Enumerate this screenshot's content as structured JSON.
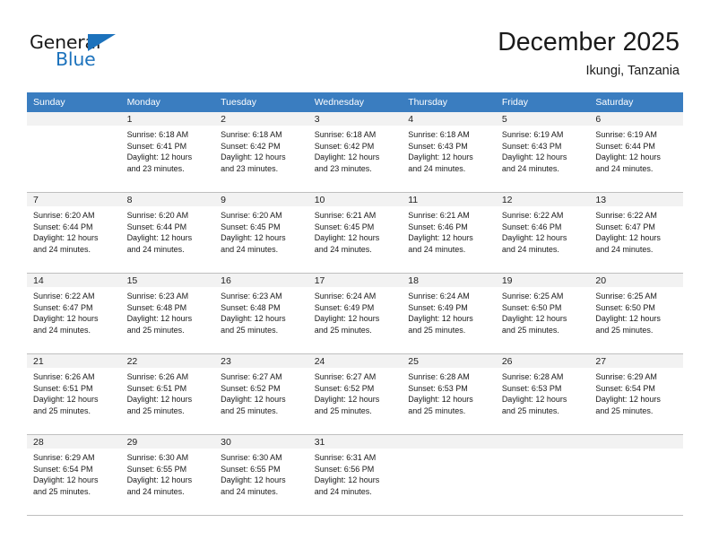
{
  "brand": {
    "name_top": "General",
    "name_bottom": "Blue",
    "triangle_icon": "triangle-icon",
    "accent_color": "#1c72bc"
  },
  "header": {
    "month_title": "December 2025",
    "location": "Ikungi, Tanzania"
  },
  "calendar": {
    "header_bg": "#3a7dc0",
    "daynum_bg": "#f2f2f2",
    "grid_line": "#bfbfbf",
    "weekday_headers": [
      "Sunday",
      "Monday",
      "Tuesday",
      "Wednesday",
      "Thursday",
      "Friday",
      "Saturday"
    ],
    "weeks": [
      [
        {
          "day": "",
          "lines": []
        },
        {
          "day": "1",
          "lines": [
            "Sunrise: 6:18 AM",
            "Sunset: 6:41 PM",
            "Daylight: 12 hours",
            "and 23 minutes."
          ]
        },
        {
          "day": "2",
          "lines": [
            "Sunrise: 6:18 AM",
            "Sunset: 6:42 PM",
            "Daylight: 12 hours",
            "and 23 minutes."
          ]
        },
        {
          "day": "3",
          "lines": [
            "Sunrise: 6:18 AM",
            "Sunset: 6:42 PM",
            "Daylight: 12 hours",
            "and 23 minutes."
          ]
        },
        {
          "day": "4",
          "lines": [
            "Sunrise: 6:18 AM",
            "Sunset: 6:43 PM",
            "Daylight: 12 hours",
            "and 24 minutes."
          ]
        },
        {
          "day": "5",
          "lines": [
            "Sunrise: 6:19 AM",
            "Sunset: 6:43 PM",
            "Daylight: 12 hours",
            "and 24 minutes."
          ]
        },
        {
          "day": "6",
          "lines": [
            "Sunrise: 6:19 AM",
            "Sunset: 6:44 PM",
            "Daylight: 12 hours",
            "and 24 minutes."
          ]
        }
      ],
      [
        {
          "day": "7",
          "lines": [
            "Sunrise: 6:20 AM",
            "Sunset: 6:44 PM",
            "Daylight: 12 hours",
            "and 24 minutes."
          ]
        },
        {
          "day": "8",
          "lines": [
            "Sunrise: 6:20 AM",
            "Sunset: 6:44 PM",
            "Daylight: 12 hours",
            "and 24 minutes."
          ]
        },
        {
          "day": "9",
          "lines": [
            "Sunrise: 6:20 AM",
            "Sunset: 6:45 PM",
            "Daylight: 12 hours",
            "and 24 minutes."
          ]
        },
        {
          "day": "10",
          "lines": [
            "Sunrise: 6:21 AM",
            "Sunset: 6:45 PM",
            "Daylight: 12 hours",
            "and 24 minutes."
          ]
        },
        {
          "day": "11",
          "lines": [
            "Sunrise: 6:21 AM",
            "Sunset: 6:46 PM",
            "Daylight: 12 hours",
            "and 24 minutes."
          ]
        },
        {
          "day": "12",
          "lines": [
            "Sunrise: 6:22 AM",
            "Sunset: 6:46 PM",
            "Daylight: 12 hours",
            "and 24 minutes."
          ]
        },
        {
          "day": "13",
          "lines": [
            "Sunrise: 6:22 AM",
            "Sunset: 6:47 PM",
            "Daylight: 12 hours",
            "and 24 minutes."
          ]
        }
      ],
      [
        {
          "day": "14",
          "lines": [
            "Sunrise: 6:22 AM",
            "Sunset: 6:47 PM",
            "Daylight: 12 hours",
            "and 24 minutes."
          ]
        },
        {
          "day": "15",
          "lines": [
            "Sunrise: 6:23 AM",
            "Sunset: 6:48 PM",
            "Daylight: 12 hours",
            "and 25 minutes."
          ]
        },
        {
          "day": "16",
          "lines": [
            "Sunrise: 6:23 AM",
            "Sunset: 6:48 PM",
            "Daylight: 12 hours",
            "and 25 minutes."
          ]
        },
        {
          "day": "17",
          "lines": [
            "Sunrise: 6:24 AM",
            "Sunset: 6:49 PM",
            "Daylight: 12 hours",
            "and 25 minutes."
          ]
        },
        {
          "day": "18",
          "lines": [
            "Sunrise: 6:24 AM",
            "Sunset: 6:49 PM",
            "Daylight: 12 hours",
            "and 25 minutes."
          ]
        },
        {
          "day": "19",
          "lines": [
            "Sunrise: 6:25 AM",
            "Sunset: 6:50 PM",
            "Daylight: 12 hours",
            "and 25 minutes."
          ]
        },
        {
          "day": "20",
          "lines": [
            "Sunrise: 6:25 AM",
            "Sunset: 6:50 PM",
            "Daylight: 12 hours",
            "and 25 minutes."
          ]
        }
      ],
      [
        {
          "day": "21",
          "lines": [
            "Sunrise: 6:26 AM",
            "Sunset: 6:51 PM",
            "Daylight: 12 hours",
            "and 25 minutes."
          ]
        },
        {
          "day": "22",
          "lines": [
            "Sunrise: 6:26 AM",
            "Sunset: 6:51 PM",
            "Daylight: 12 hours",
            "and 25 minutes."
          ]
        },
        {
          "day": "23",
          "lines": [
            "Sunrise: 6:27 AM",
            "Sunset: 6:52 PM",
            "Daylight: 12 hours",
            "and 25 minutes."
          ]
        },
        {
          "day": "24",
          "lines": [
            "Sunrise: 6:27 AM",
            "Sunset: 6:52 PM",
            "Daylight: 12 hours",
            "and 25 minutes."
          ]
        },
        {
          "day": "25",
          "lines": [
            "Sunrise: 6:28 AM",
            "Sunset: 6:53 PM",
            "Daylight: 12 hours",
            "and 25 minutes."
          ]
        },
        {
          "day": "26",
          "lines": [
            "Sunrise: 6:28 AM",
            "Sunset: 6:53 PM",
            "Daylight: 12 hours",
            "and 25 minutes."
          ]
        },
        {
          "day": "27",
          "lines": [
            "Sunrise: 6:29 AM",
            "Sunset: 6:54 PM",
            "Daylight: 12 hours",
            "and 25 minutes."
          ]
        }
      ],
      [
        {
          "day": "28",
          "lines": [
            "Sunrise: 6:29 AM",
            "Sunset: 6:54 PM",
            "Daylight: 12 hours",
            "and 25 minutes."
          ]
        },
        {
          "day": "29",
          "lines": [
            "Sunrise: 6:30 AM",
            "Sunset: 6:55 PM",
            "Daylight: 12 hours",
            "and 24 minutes."
          ]
        },
        {
          "day": "30",
          "lines": [
            "Sunrise: 6:30 AM",
            "Sunset: 6:55 PM",
            "Daylight: 12 hours",
            "and 24 minutes."
          ]
        },
        {
          "day": "31",
          "lines": [
            "Sunrise: 6:31 AM",
            "Sunset: 6:56 PM",
            "Daylight: 12 hours",
            "and 24 minutes."
          ]
        },
        {
          "day": "",
          "lines": []
        },
        {
          "day": "",
          "lines": []
        },
        {
          "day": "",
          "lines": []
        }
      ]
    ]
  }
}
